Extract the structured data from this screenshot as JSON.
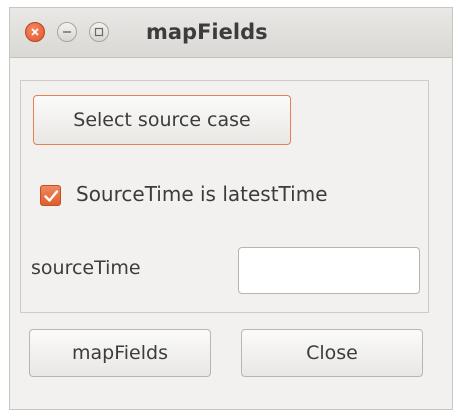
{
  "window": {
    "title": "mapFields"
  },
  "titlebar_buttons": {
    "close_icon": "close-icon",
    "minimize_icon": "minimize-icon",
    "maximize_icon": "maximize-icon"
  },
  "form": {
    "select_source_label": "Select source case",
    "checkbox_label": "SourceTime is latestTime",
    "checkbox_checked": true,
    "source_time_label": "sourceTime",
    "source_time_value": "",
    "source_time_placeholder": ""
  },
  "actions": {
    "mapfields_label": "mapFields",
    "close_label": "Close"
  },
  "colors": {
    "accent": "#e05c2e",
    "window_bg": "#f2f1f0",
    "text": "#3c3c3c"
  }
}
